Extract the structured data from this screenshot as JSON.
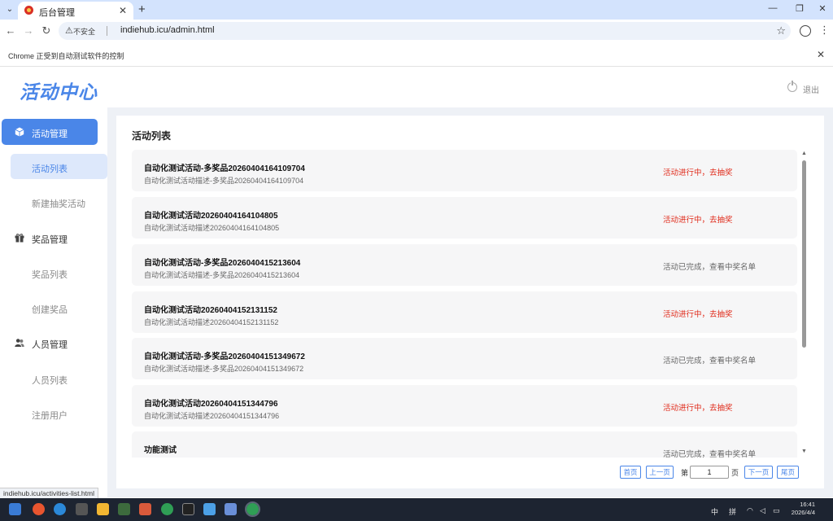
{
  "browser": {
    "tab_title": "后台管理",
    "url": "indiehub.icu/admin.html",
    "insecure_label": "不安全",
    "automation_notice": "Chrome 正受到自动测试软件的控制"
  },
  "header": {
    "logo": "活动中心",
    "logout": "退出"
  },
  "sidebar": {
    "groups": [
      {
        "label": "活动管理",
        "items": [
          "活动列表",
          "新建抽奖活动"
        ]
      },
      {
        "label": "奖品管理",
        "items": [
          "奖品列表",
          "创建奖品"
        ]
      },
      {
        "label": "人员管理",
        "items": [
          "人员列表",
          "注册用户"
        ]
      }
    ]
  },
  "main": {
    "title": "活动列表",
    "activities": [
      {
        "name": "自动化测试活动-多奖品20260404164109704",
        "desc": "自动化测试活动描述-多奖品20260404164109704",
        "status": "活动进行中，去抽奖"
      },
      {
        "name": "自动化测试活动20260404164104805",
        "desc": "自动化测试活动描述20260404164104805",
        "status": "活动进行中，去抽奖"
      },
      {
        "name": "自动化测试活动-多奖品20260404152136​04",
        "desc": "自动化测试活动描述-多奖品20260404152136​04",
        "status": "活动已完成，查看中奖名单"
      },
      {
        "name": "自动化测试活动20260404152131152",
        "desc": "自动化测试活动描述20260404152131152",
        "status": "活动进行中，去抽奖"
      },
      {
        "name": "自动化测试活动-多奖品20260404151349672",
        "desc": "自动化测试活动描述-多奖品20260404151349672",
        "status": "活动已完成，查看中奖名单"
      },
      {
        "name": "自动化测试活动20260404151344796",
        "desc": "自动化测试活动描述20260404151344796",
        "status": "活动进行中，去抽奖"
      },
      {
        "name": "功能测试",
        "desc": "",
        "status": "活动已完成，查看中奖名单"
      }
    ],
    "pagination": {
      "first": "首页",
      "prev": "上一页",
      "page_prefix": "第",
      "page_value": "1",
      "page_suffix": "页",
      "next": "下一页",
      "last": "尾页"
    }
  },
  "status_bar_url": "indiehub.icu/activities-list.html",
  "taskbar": {
    "ime_1": "中",
    "ime_2": "拼",
    "time": "16:41",
    "date": "2026/4/4"
  },
  "colors": {
    "accent": "#4a86e8",
    "running": "#e02b1b",
    "done": "#666666"
  }
}
